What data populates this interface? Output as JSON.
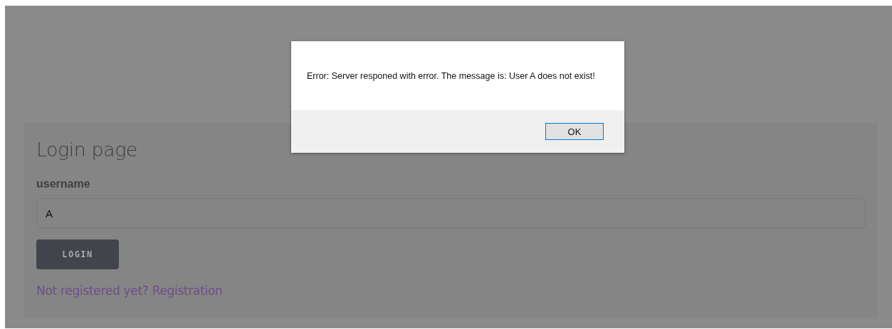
{
  "login_form": {
    "title": "Login page",
    "username_label": "username",
    "username_value": "A",
    "login_button": "LOGIN",
    "registration_link": "Not registered yet? Registration"
  },
  "alert_dialog": {
    "message": "Error: Server responed with error. The message is: User A does not exist!",
    "ok_button": "OK"
  }
}
